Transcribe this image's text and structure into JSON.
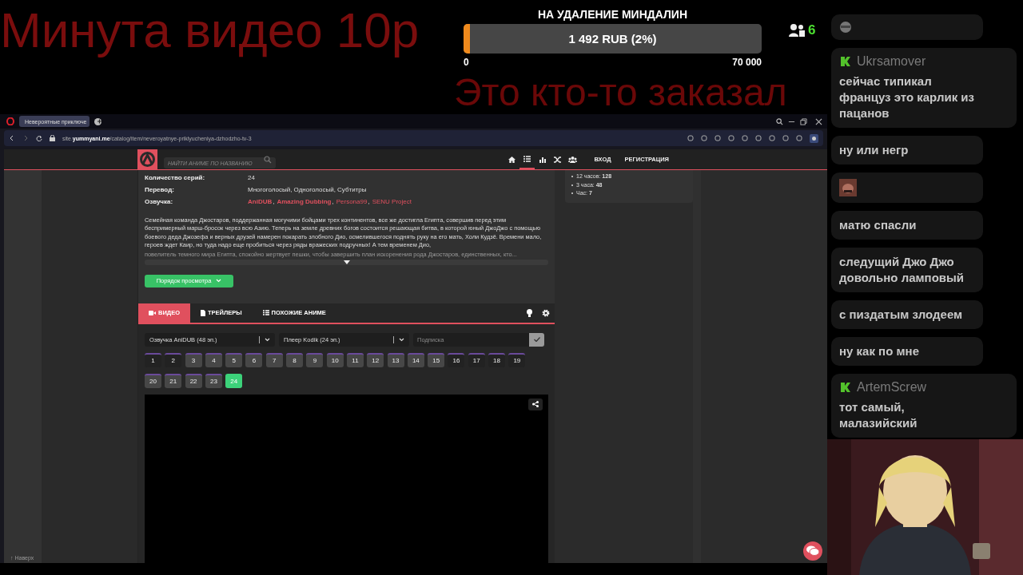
{
  "overlay": {
    "promo_text": "Минута видео 10р",
    "goal": {
      "title": "НА УДАЛЕНИЕ МИНДАЛИН",
      "amount": "1 492 RUB (2%)",
      "level": 0.021,
      "min": "0",
      "max": "70 000"
    },
    "viewers": "6",
    "alert_text": "Это кто-то заказал"
  },
  "browser": {
    "tab_title": "Невероятные приключе",
    "url": "site.**yummyani.me**/catalog/item/neveroyatnye-priklyucheniya-dzhodzho-tv-3"
  },
  "site": {
    "search_placeholder": "НАЙТИ АНИМЕ ПО НАЗВАНИЮ",
    "nav_icons": [
      {
        "kind": "home",
        "selected": false
      },
      {
        "kind": "list",
        "selected": true
      },
      {
        "kind": "chart",
        "selected": false
      },
      {
        "kind": "shuffle",
        "selected": false
      },
      {
        "kind": "users",
        "selected": false
      }
    ],
    "nav_links": [
      "ВХОД",
      "РЕГИСТРАЦИЯ"
    ],
    "info": [
      {
        "label": "Количество серий:",
        "value": "24"
      },
      {
        "label": "Перевод:",
        "value": "Многоголосый, Одноголосый, Субтитры"
      }
    ],
    "dubbing": {
      "label": "Озвучка:",
      "separator": ",",
      "items": [
        {
          "name": "AniDUB",
          "bold": true
        },
        {
          "name": "Amazing Dubbing",
          "bold": true
        },
        {
          "name": "Persona99",
          "bold": false
        },
        {
          "name": "SENU Project",
          "bold": false
        }
      ]
    },
    "description": "Семейная команда Джостаров, поддержанная могучими бойцами трех континентов, все же достигла Египта, совершив перед этим беспримерный марш-бросок через всю Азию. Теперь на земле древних богов состоится решающая битва, в которой юный ДжоДжо с помощью боевого деда Джозефа и верных друзей намерен покарать злобного Дио, осмелившегося поднять руку на его мать, Холи Кудзё. Времени мало, героев ждет Каир, но туда надо еще пробиться через ряды вражеских подручных! А тем временем Дио,",
    "description_faded": "повелитель темного мира Египта, спокойно жертвует пешки, чтобы завершить план искоренения рода Джостаров, единственных, кто...",
    "order_button": "Порядок просмотра",
    "tabs": [
      {
        "label": "ВИДЕО",
        "kind": "video",
        "selected": true
      },
      {
        "label": "ТРЕЙЛЕРЫ",
        "kind": "file",
        "selected": false
      },
      {
        "label": "ПОХОЖИЕ АНИМЕ",
        "kind": "list",
        "selected": false
      }
    ],
    "dub_select": "Озвучка AniDUB (48 эп.)",
    "player_select": "Плеер Kodik (24 эп.)",
    "subscribe_placeholder": "Подписка",
    "episodes": [
      {
        "n": "1",
        "dark": true,
        "selected": false
      },
      {
        "n": "2",
        "dark": true,
        "selected": false
      },
      {
        "n": "3",
        "dark": false,
        "selected": false
      },
      {
        "n": "4",
        "dark": false,
        "selected": false
      },
      {
        "n": "5",
        "dark": false,
        "selected": false
      },
      {
        "n": "6",
        "dark": false,
        "selected": false
      },
      {
        "n": "7",
        "dark": false,
        "selected": false
      },
      {
        "n": "8",
        "dark": false,
        "selected": false
      },
      {
        "n": "9",
        "dark": false,
        "selected": false
      },
      {
        "n": "10",
        "dark": false,
        "selected": false
      },
      {
        "n": "11",
        "dark": false,
        "selected": false
      },
      {
        "n": "12",
        "dark": false,
        "selected": false
      },
      {
        "n": "13",
        "dark": false,
        "selected": false
      },
      {
        "n": "14",
        "dark": false,
        "selected": false
      },
      {
        "n": "15",
        "dark": false,
        "selected": false
      },
      {
        "n": "16",
        "dark": true,
        "selected": false
      },
      {
        "n": "17",
        "dark": true,
        "selected": false
      },
      {
        "n": "18",
        "dark": true,
        "selected": false
      },
      {
        "n": "19",
        "dark": true,
        "selected": false
      },
      {
        "n": "20",
        "dark": false,
        "selected": false
      },
      {
        "n": "21",
        "dark": false,
        "selected": false
      },
      {
        "n": "22",
        "dark": false,
        "selected": false
      },
      {
        "n": "23",
        "dark": false,
        "selected": false
      },
      {
        "n": "24",
        "dark": false,
        "selected": true
      }
    ],
    "stats": [
      "12 часов: **128**",
      "3 часа: **48**",
      "Час: **7**"
    ],
    "back_to_top": "↑ Наверх"
  },
  "chat": [
    {
      "kind": "emote"
    },
    {
      "kind": "text",
      "author": "Ukrsamover",
      "text": "сейчас типикал француз это карлик из пацанов"
    },
    {
      "kind": "text",
      "text": "ну или негр"
    },
    {
      "kind": "emote"
    },
    {
      "kind": "text",
      "text": "матю спасли"
    },
    {
      "kind": "text",
      "text": "следущий Джо Джо довольно ламповый"
    },
    {
      "kind": "text",
      "text": "с пиздатым злодеем"
    },
    {
      "kind": "text",
      "text": "ну как по мне"
    },
    {
      "kind": "text",
      "author": "ArtemScrew",
      "text": "тот самый, малазийский"
    }
  ]
}
